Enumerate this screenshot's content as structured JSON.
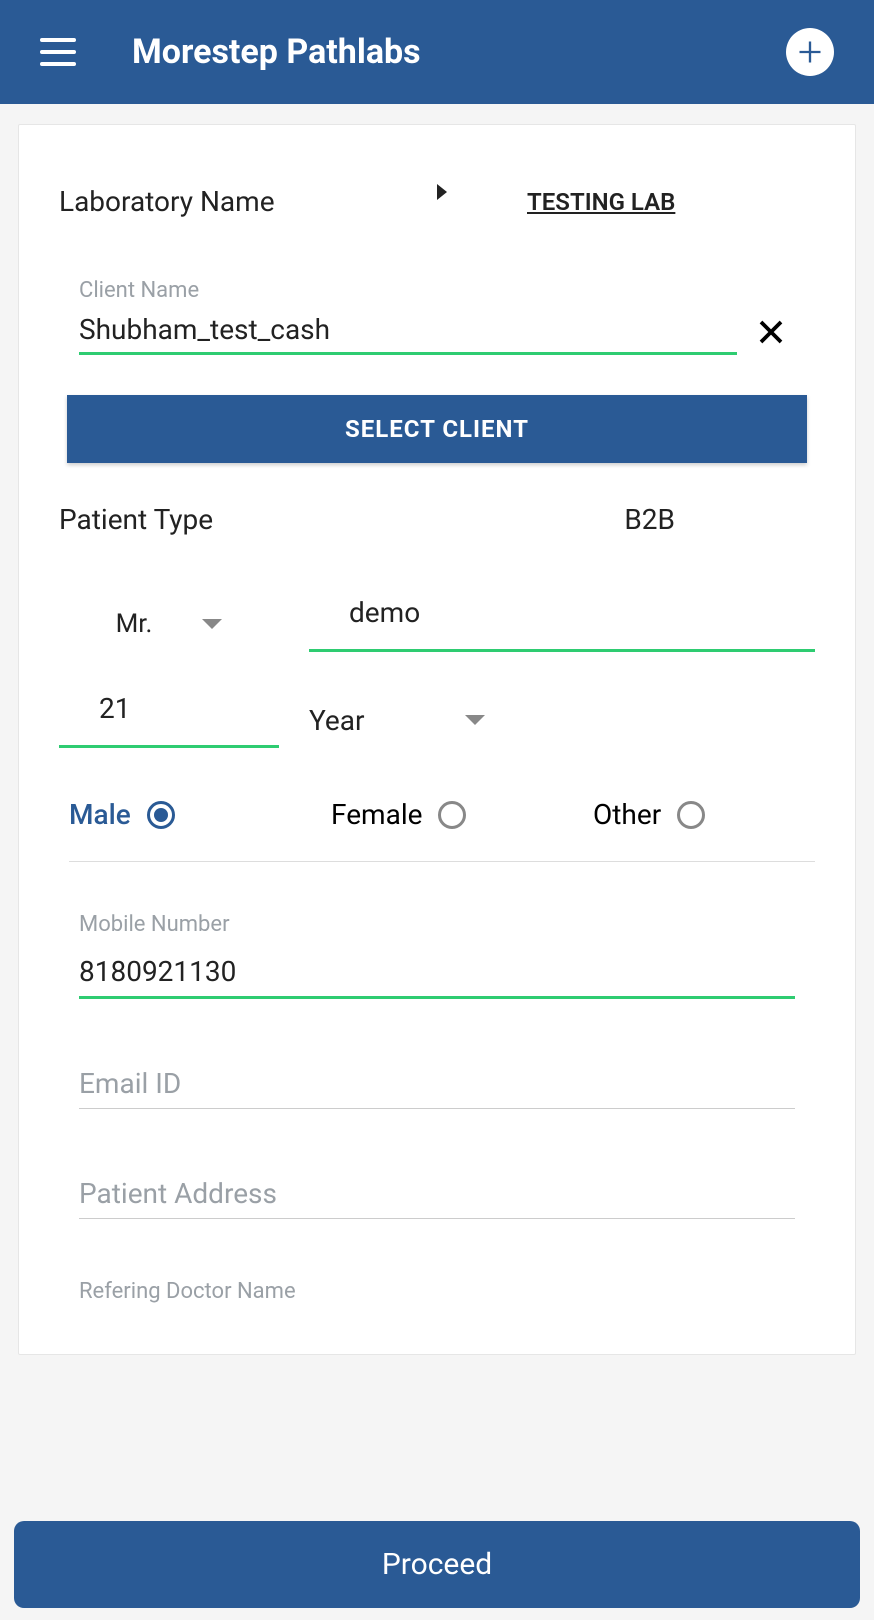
{
  "header": {
    "title": "Morestep Pathlabs"
  },
  "lab": {
    "label": "Laboratory Name",
    "value": "TESTING LAB"
  },
  "client": {
    "label": "Client Name",
    "value": "Shubham_test_cash",
    "select_btn": "SELECT CLIENT"
  },
  "patient_type": {
    "label": "Patient Type",
    "value": "B2B"
  },
  "name": {
    "title": "Mr.",
    "value": "demo"
  },
  "age": {
    "value": "21",
    "unit": "Year"
  },
  "gender": {
    "options": [
      "Male",
      "Female",
      "Other"
    ],
    "selected": "Male"
  },
  "mobile": {
    "label": "Mobile Number",
    "value": "8180921130"
  },
  "email": {
    "placeholder": "Email ID",
    "value": ""
  },
  "address": {
    "placeholder": "Patient Address",
    "value": ""
  },
  "refdoc": {
    "placeholder": "Refering Doctor Name",
    "value": ""
  },
  "proceed": "Proceed"
}
